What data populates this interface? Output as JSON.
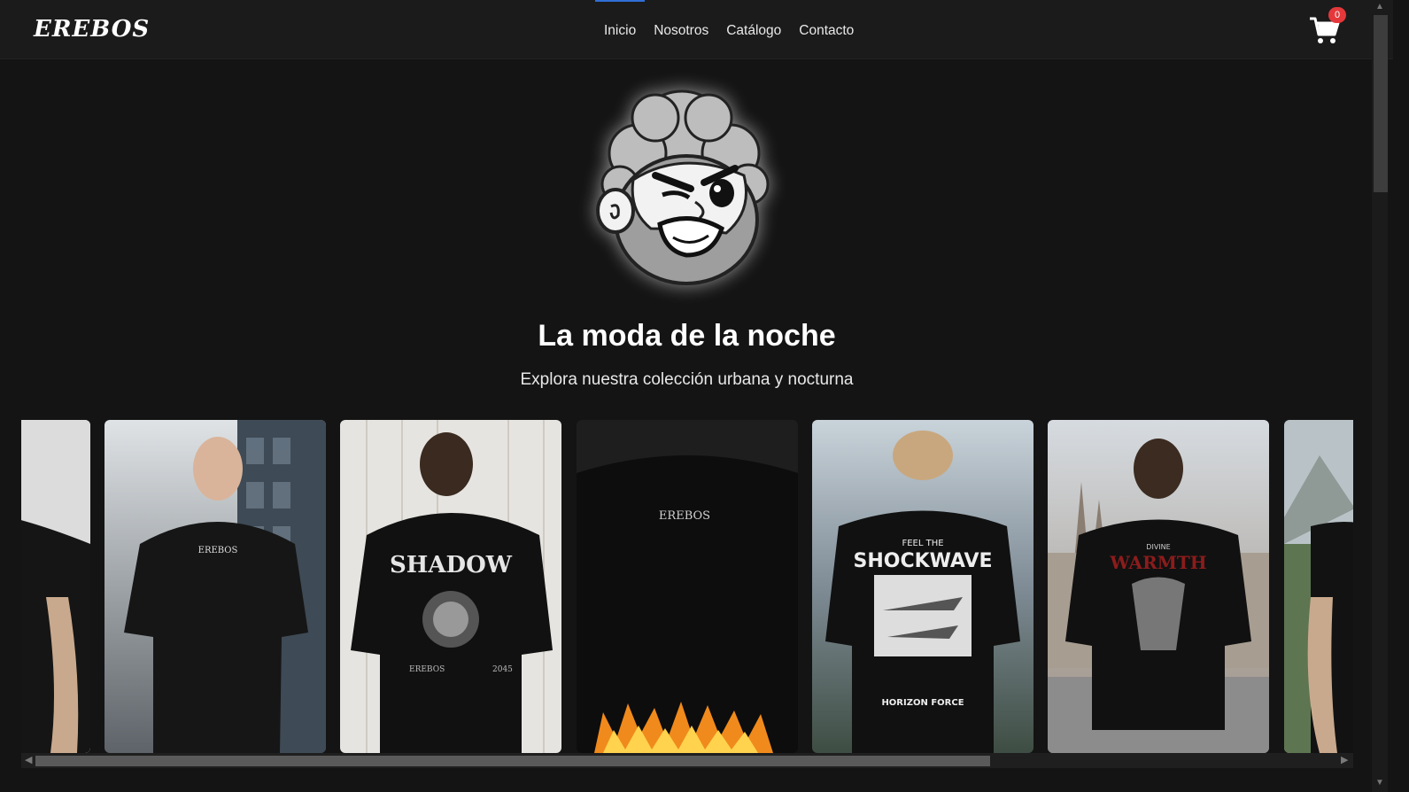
{
  "brand": {
    "name": "EREBOS"
  },
  "nav": {
    "items": [
      {
        "label": "Inicio",
        "active": true
      },
      {
        "label": "Nosotros",
        "active": false
      },
      {
        "label": "Catálogo",
        "active": false
      },
      {
        "label": "Contacto",
        "active": false
      }
    ],
    "accent_color": "#2f6fd6"
  },
  "cart": {
    "count": "0",
    "icon": "shopping-cart-icon",
    "badge_color": "#e5383b"
  },
  "hero": {
    "mascot_icon": "mascot-angry-face-icon",
    "title": "La moda de la noche",
    "subtitle": "Explora nuestra colección urbana y nocturna"
  },
  "gallery": {
    "items": [
      {
        "name": "tattooed-arm-shirt-partial",
        "shirt_print": ""
      },
      {
        "name": "erebos-logo-tee-front",
        "shirt_print": "EREBOS"
      },
      {
        "name": "shadow-tee-back",
        "shirt_print": "SHADOW",
        "shirt_print_2": "EREBOS",
        "shirt_print_3": "2045"
      },
      {
        "name": "erebos-flames-tee",
        "shirt_print": "EREBOS"
      },
      {
        "name": "shockwave-tee-back",
        "shirt_print": "FEEL THE",
        "shirt_print_2": "SHOCKWAVE",
        "shirt_print_3": "HORIZON FORCE"
      },
      {
        "name": "divine-warmth-tee-back",
        "shirt_print": "DIVINE",
        "shirt_print_2": "WARMTH"
      },
      {
        "name": "mountain-tee-partial",
        "shirt_print": ""
      }
    ]
  },
  "scroll": {
    "horizontal_progress": 0.0,
    "vertical_progress": 0.0
  }
}
